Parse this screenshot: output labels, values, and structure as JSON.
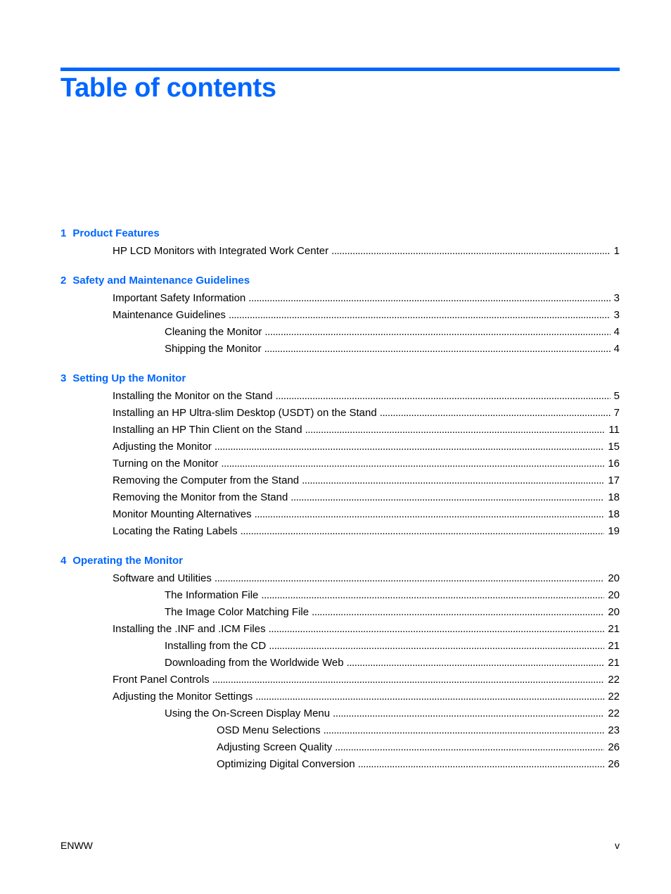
{
  "page": {
    "title": "Table of contents",
    "accent_color": "#0066ff"
  },
  "chapters": [
    {
      "number": "1",
      "title": "Product Features",
      "entries": [
        {
          "level": 1,
          "label": "HP LCD Monitors with Integrated Work Center",
          "page": "1"
        }
      ]
    },
    {
      "number": "2",
      "title": "Safety and Maintenance Guidelines",
      "entries": [
        {
          "level": 1,
          "label": "Important Safety Information",
          "page": "3"
        },
        {
          "level": 1,
          "label": "Maintenance Guidelines",
          "page": "3"
        },
        {
          "level": 2,
          "label": "Cleaning the Monitor",
          "page": "4"
        },
        {
          "level": 2,
          "label": "Shipping the Monitor",
          "page": "4"
        }
      ]
    },
    {
      "number": "3",
      "title": "Setting Up the Monitor",
      "entries": [
        {
          "level": 1,
          "label": "Installing the Monitor on the Stand",
          "page": "5"
        },
        {
          "level": 1,
          "label": "Installing an HP Ultra-slim Desktop (USDT) on the Stand",
          "page": "7"
        },
        {
          "level": 1,
          "label": "Installing an HP Thin Client on the Stand",
          "page": "11"
        },
        {
          "level": 1,
          "label": "Adjusting the Monitor",
          "page": "15"
        },
        {
          "level": 1,
          "label": "Turning on the Monitor",
          "page": "16"
        },
        {
          "level": 1,
          "label": "Removing the Computer from the Stand",
          "page": "17"
        },
        {
          "level": 1,
          "label": "Removing the Monitor from the Stand",
          "page": "18"
        },
        {
          "level": 1,
          "label": "Monitor Mounting Alternatives",
          "page": "18"
        },
        {
          "level": 1,
          "label": "Locating the Rating Labels",
          "page": "19"
        }
      ]
    },
    {
      "number": "4",
      "title": "Operating the Monitor",
      "entries": [
        {
          "level": 1,
          "label": "Software and Utilities",
          "page": "20"
        },
        {
          "level": 2,
          "label": "The Information File",
          "page": "20"
        },
        {
          "level": 2,
          "label": "The Image Color Matching File",
          "page": "20"
        },
        {
          "level": 1,
          "label": "Installing the .INF and .ICM Files",
          "page": "21"
        },
        {
          "level": 2,
          "label": "Installing from the CD",
          "page": "21"
        },
        {
          "level": 2,
          "label": "Downloading from the Worldwide Web",
          "page": "21"
        },
        {
          "level": 1,
          "label": "Front Panel Controls",
          "page": "22"
        },
        {
          "level": 1,
          "label": "Adjusting the Monitor Settings",
          "page": "22"
        },
        {
          "level": 2,
          "label": "Using the On-Screen Display Menu",
          "page": "22"
        },
        {
          "level": 3,
          "label": "OSD Menu Selections",
          "page": "23"
        },
        {
          "level": 3,
          "label": "Adjusting Screen Quality",
          "page": "26"
        },
        {
          "level": 3,
          "label": "Optimizing Digital Conversion",
          "page": "26"
        }
      ]
    }
  ],
  "footer": {
    "left": "ENWW",
    "right": "v"
  }
}
